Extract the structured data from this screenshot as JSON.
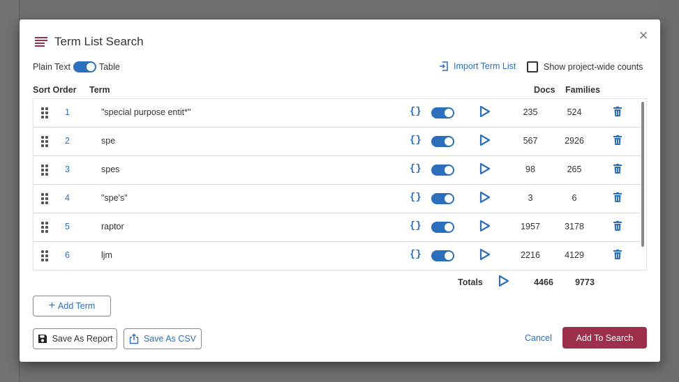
{
  "modal": {
    "title": "Term List Search",
    "toggle": {
      "left_label": "Plain Text",
      "right_label": "Table",
      "state": "table"
    },
    "import_label": "Import Term List",
    "show_counts_label": "Show project-wide counts",
    "show_counts_checked": false,
    "columns": {
      "sort_order": "Sort Order",
      "term": "Term",
      "docs": "Docs",
      "families": "Families"
    },
    "rows": [
      {
        "order": "1",
        "term": "\"special purpose entit*\"",
        "braces": "{}",
        "enabled": true,
        "docs": "235",
        "families": "524"
      },
      {
        "order": "2",
        "term": "spe",
        "braces": "{}",
        "enabled": true,
        "docs": "567",
        "families": "2926"
      },
      {
        "order": "3",
        "term": "spes",
        "braces": "{}",
        "enabled": true,
        "docs": "98",
        "families": "265"
      },
      {
        "order": "4",
        "term": "\"spe's\"",
        "braces": "{}",
        "enabled": true,
        "docs": "3",
        "families": "6"
      },
      {
        "order": "5",
        "term": "raptor",
        "braces": "{}",
        "enabled": true,
        "docs": "1957",
        "families": "3178"
      },
      {
        "order": "6",
        "term": "ljm",
        "braces": "{}",
        "enabled": true,
        "docs": "2216",
        "families": "4129"
      }
    ],
    "totals": {
      "label": "Totals",
      "docs": "4466",
      "families": "9773"
    },
    "buttons": {
      "add_term": "Add Term",
      "save_report": "Save As Report",
      "save_csv": "Save As CSV",
      "cancel": "Cancel",
      "add_to_search": "Add To Search"
    }
  },
  "colors": {
    "accent": "#2a6ebc",
    "brand": "#9b2f4c",
    "text": "#333333"
  },
  "icons": [
    "menu-lines-icon",
    "close-icon",
    "import-icon",
    "drag-handle-icon",
    "braces-icon",
    "play-icon",
    "trash-icon",
    "plus-icon",
    "save-icon",
    "export-icon"
  ]
}
